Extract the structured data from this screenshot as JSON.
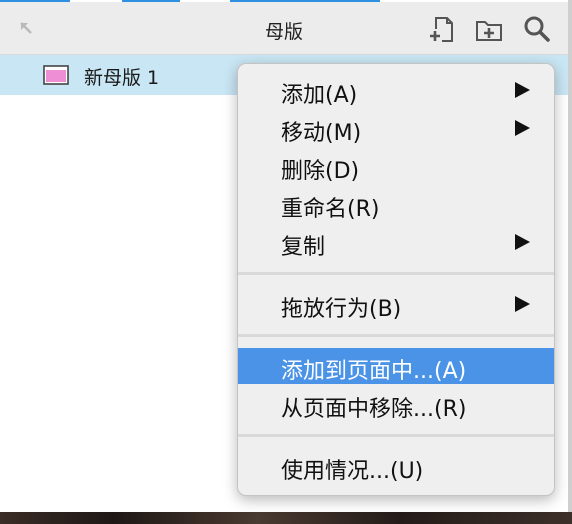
{
  "panel": {
    "title": "母版",
    "icons": {
      "collapse": "collapse-arrow-icon",
      "add_master": "add-master-icon",
      "add_folder": "add-folder-icon",
      "search": "search-icon"
    }
  },
  "tree": {
    "items": [
      {
        "label": "新母版 1",
        "icon": "master-page-icon",
        "selected": true
      }
    ]
  },
  "context_menu": {
    "groups": [
      [
        {
          "label": "添加(A)",
          "submenu": true
        },
        {
          "label": "移动(M)",
          "submenu": true
        },
        {
          "label": "删除(D)",
          "submenu": false
        },
        {
          "label": "重命名(R)",
          "submenu": false
        },
        {
          "label": "复制",
          "submenu": true
        }
      ],
      [
        {
          "label": "拖放行为(B)",
          "submenu": true
        }
      ],
      [
        {
          "label": "添加到页面中...(A)",
          "submenu": false,
          "highlighted": true
        },
        {
          "label": "从页面中移除...(R)",
          "submenu": false
        }
      ],
      [
        {
          "label": "使用情况...(U)",
          "submenu": false
        }
      ]
    ]
  },
  "colors": {
    "selection_row": "#c9e6f4",
    "menu_highlight": "#4a93e7",
    "accent": "#2f8fe0",
    "master_icon_fill": "#ee8fd6"
  }
}
